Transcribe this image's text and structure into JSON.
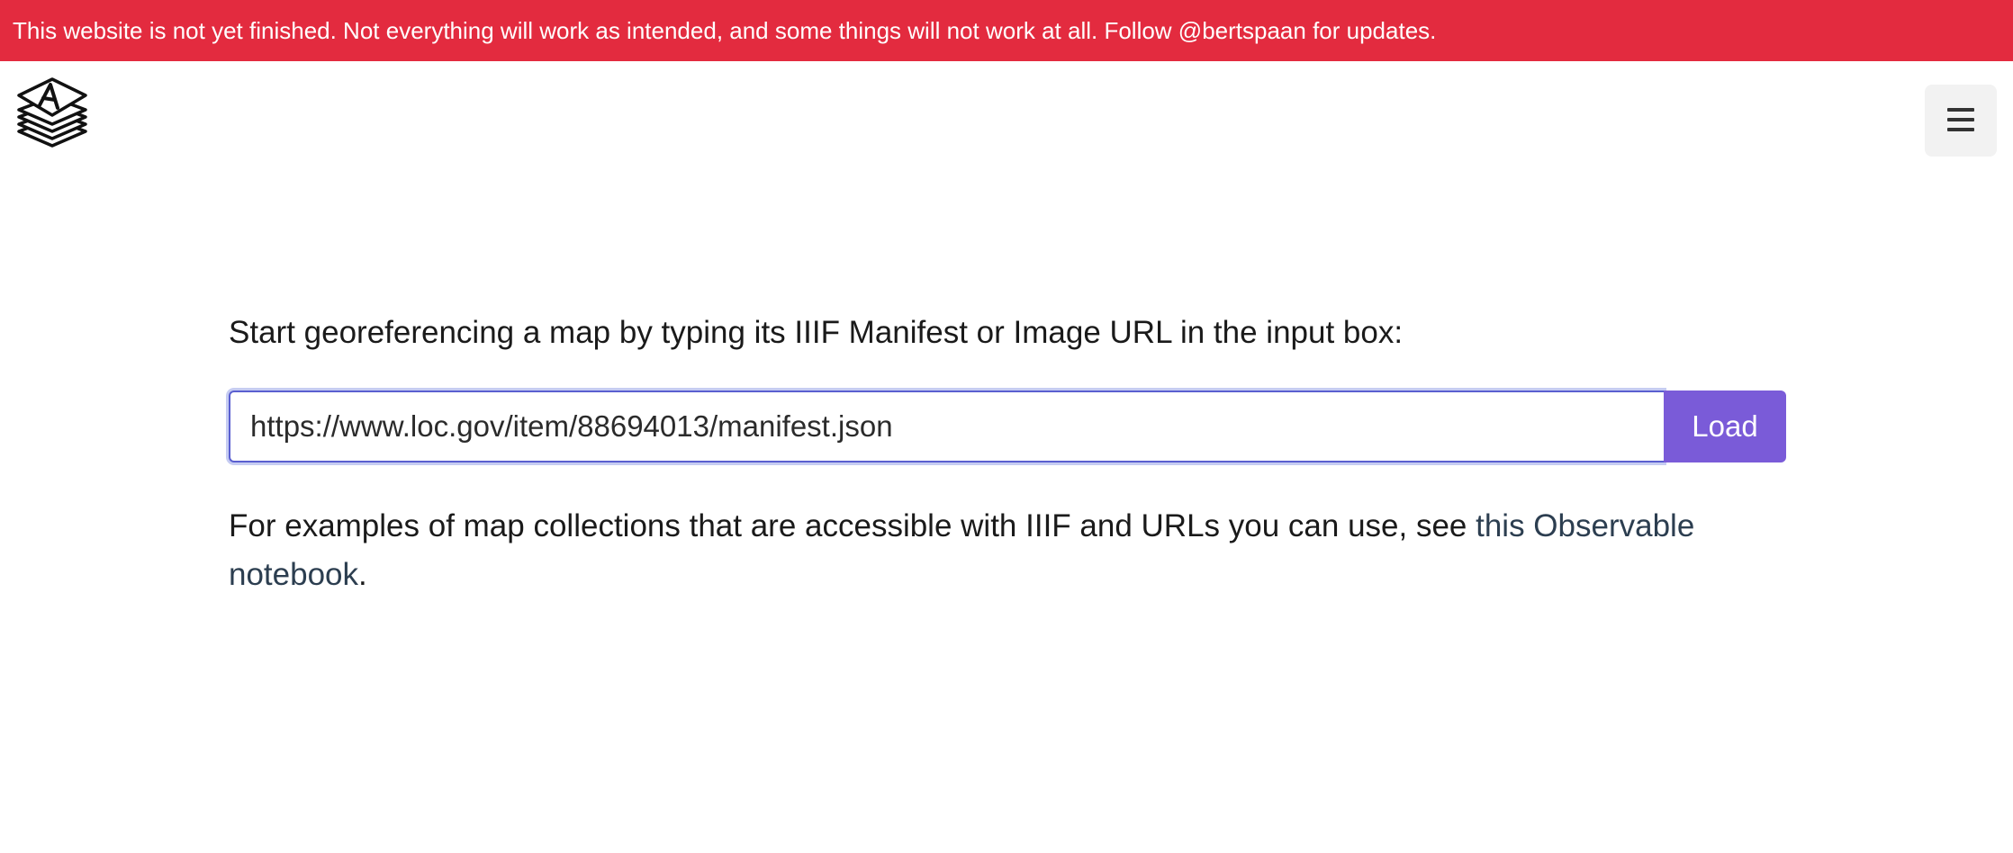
{
  "banner": {
    "text": "This website is not yet finished. Not everything will work as intended, and some things will not work at all. Follow @bertspaan for updates."
  },
  "header": {
    "logo_icon": "stacked-layers-logo-icon",
    "menu_icon": "hamburger-menu-icon"
  },
  "main": {
    "intro": "Start georeferencing a map by typing its IIIF Manifest or Image URL in the input box:",
    "url_input_value": "https://www.loc.gov/item/88694013/manifest.json",
    "load_label": "Load",
    "examples_text": "For examples of map collections that are accessible with IIIF and URLs you can use, see ",
    "examples_link": "this Observable notebook",
    "examples_end": "."
  },
  "colors": {
    "banner": "#e32b3f",
    "button": "#7a5bd8",
    "input_border": "#5a5fd0",
    "link": "#2c3e50"
  }
}
